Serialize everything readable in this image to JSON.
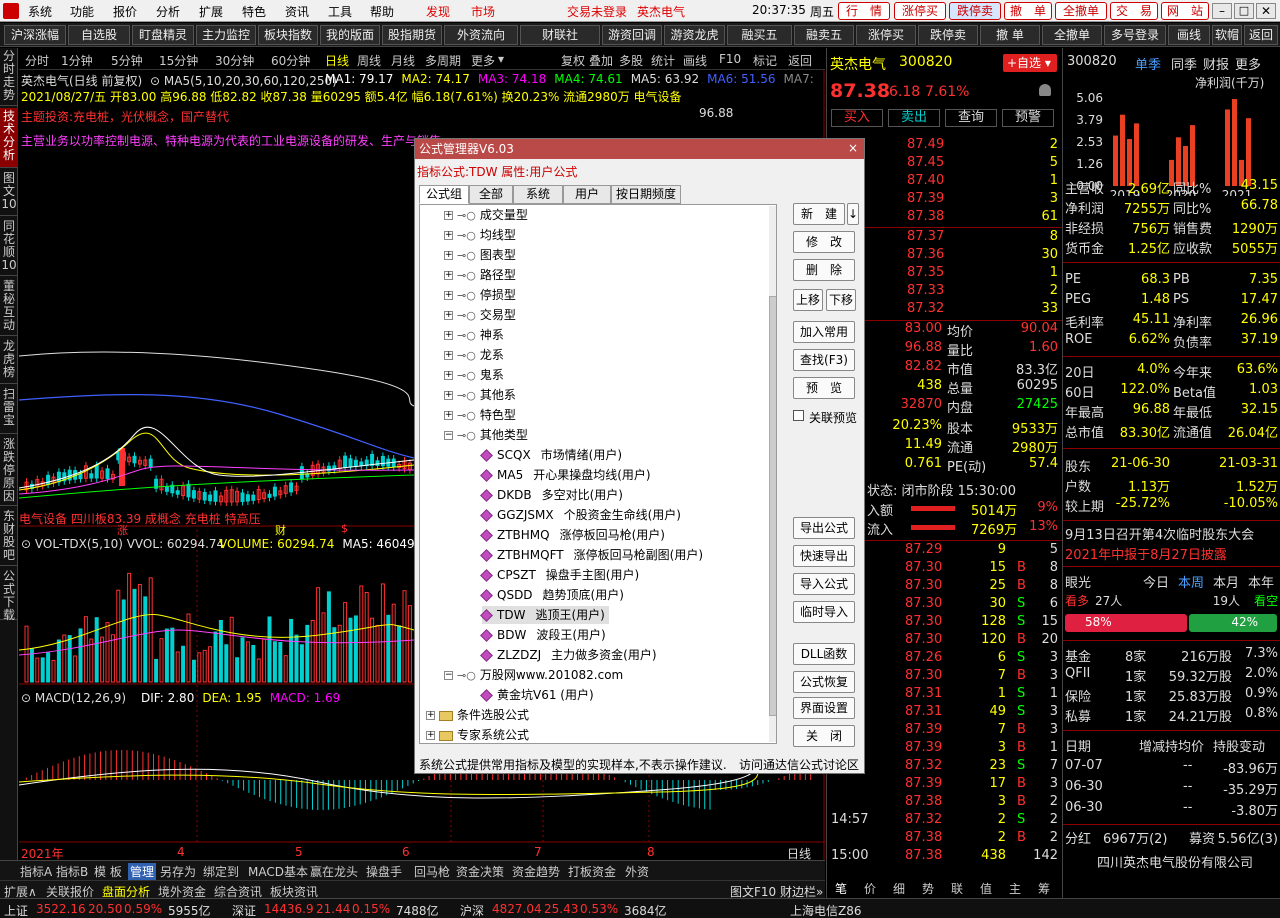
{
  "menu": {
    "items": [
      "系统",
      "功能",
      "报价",
      "分析",
      "扩展",
      "特色",
      "资讯",
      "工具",
      "帮助"
    ],
    "warn": "发现",
    "market": "市场",
    "login_status": "交易未登录",
    "stock_tag": "英杰电气",
    "time": "20:37:35",
    "weekday": "周五",
    "right_buttons": [
      "行　情",
      "涨停买",
      "跌停卖",
      "撤　单",
      "全撤单",
      "交　易",
      "网　站"
    ]
  },
  "toolbar": {
    "buttons": [
      "沪深涨幅",
      "自选股",
      "盯盘精灵",
      "主力监控",
      "板块指数",
      "我的版面",
      "股指期货",
      "外资流向",
      "财联社",
      "游资回调",
      "游资龙虎",
      "融买五",
      "融卖五",
      "涨停买",
      "跌停卖",
      "撤 单",
      "全撤单",
      "多号登录",
      "画线",
      "软帽",
      "返回"
    ]
  },
  "left_tabs": [
    "分时走势",
    "技术分析",
    "图文10",
    "同花顺10",
    "董秘互动",
    "龙虎榜",
    "扫雷宝",
    "涨跌停原因",
    "东财股吧",
    "公式下载"
  ],
  "period": {
    "items": [
      "分时",
      "1分钟",
      "5分钟",
      "15分钟",
      "30分钟",
      "60分钟",
      "日线",
      "周线",
      "月线",
      "多周期",
      "更多"
    ],
    "active": "日线",
    "right": [
      "复权",
      "叠加",
      "多股",
      "统计",
      "画线",
      "F10",
      "标记",
      "返回"
    ]
  },
  "chart": {
    "title": "英杰电气(日线 前复权)",
    "ma_label": "MA5(5,10,20,30,60,120,250)",
    "ma": [
      {
        "t": "MA1: 79.17",
        "c": "#ffffff"
      },
      {
        "t": "MA2: 74.17",
        "c": "#ffff00"
      },
      {
        "t": "MA3: 74.18",
        "c": "#ff00ff"
      },
      {
        "t": "MA4: 74.61",
        "c": "#00ff00"
      },
      {
        "t": "MA5: 63.92",
        "c": "#dddddd"
      },
      {
        "t": "MA6: 51.56",
        "c": "#4060ff"
      },
      {
        "t": "MA7:",
        "c": "#888888"
      }
    ],
    "bar_info": "2021/08/27/五 开83.00 高96.88 低82.82 收87.38 量60295 额5.4亿 幅6.18(7.61%) 换20.23% 流通2980万 电气设备",
    "theme1": "主题投资:充电桩，光伏概念，国产替代",
    "theme2": "主营业务以功率控制电源、特种电源为代表的工业电源设备的研发、生产与销售",
    "max_label": "96.88",
    "bottom_note": "电气设备 四川板83.39 成概念 充电桩 特高压",
    "marks": [
      "涨",
      "财",
      "$"
    ],
    "vol_label": "VOL-TDX(5,10) VVOL: 60294.74",
    "vol_vals": [
      {
        "t": "VOLUME: 60294.74",
        "c": "#ffff00"
      },
      {
        "t": "MA5: 46049.09",
        "c": "#ffffff"
      }
    ],
    "macd_label": "MACD(12,26,9)",
    "macd_vals": [
      {
        "t": "DIF: 2.80",
        "c": "#ffffff"
      },
      {
        "t": "DEA: 1.95",
        "c": "#ffff00"
      },
      {
        "t": "MACD: 1.69",
        "c": "#ff00ff"
      }
    ],
    "xaxis": [
      "2021年",
      "4",
      "5",
      "6",
      "7",
      "8"
    ],
    "daily_btn": "日线"
  },
  "bottom_tabs": [
    "指标A",
    "指标B",
    "模 板",
    "管理",
    "另存为",
    "绑定到",
    "MACD基本",
    "赢在龙头",
    "操盘手",
    "回马枪",
    "资金决策",
    "资金趋势",
    "打板资金",
    "外资"
  ],
  "bottom_tabs2": [
    "扩展∧",
    "关联报价",
    "盘面分析",
    "境外资金",
    "综合资讯",
    "板块资讯"
  ],
  "bottom_right": "图文F10 财边栏»",
  "status": {
    "items": [
      {
        "n": "上证",
        "v": "3522.16",
        "c": "20.50",
        "p": "0.59%",
        "a": "5955亿"
      },
      {
        "n": "深证",
        "v": "14436.9",
        "c": "21.44",
        "p": "0.15%",
        "a": "7488亿"
      },
      {
        "n": "沪深",
        "v": "4827.04",
        "c": "25.43",
        "p": "0.53%",
        "a": "3684亿"
      }
    ],
    "server": "上海电信Z86"
  },
  "quote": {
    "name": "英杰电气",
    "code": "300820",
    "add": "+自选",
    "price": "87.38",
    "chg": "6.18",
    "pct": "7.61%",
    "btns": [
      "买入",
      "卖出",
      "查询",
      "预警"
    ],
    "asks": [
      {
        "p": "87.49",
        "v": "2"
      },
      {
        "p": "87.45",
        "v": "5"
      },
      {
        "p": "87.40",
        "v": "1"
      },
      {
        "p": "87.39",
        "v": "3"
      },
      {
        "p": "87.38",
        "v": "61"
      }
    ],
    "bids": [
      {
        "p": "87.37",
        "v": "8"
      },
      {
        "p": "87.36",
        "v": "30"
      },
      {
        "p": "87.35",
        "v": "1"
      },
      {
        "p": "87.33",
        "v": "2"
      },
      {
        "p": "87.32",
        "v": "33"
      }
    ],
    "stats": [
      {
        "a": "83.00",
        "l": "均价",
        "b": "90.04",
        "bc": "#ff3333"
      },
      {
        "a": "96.88",
        "l": "量比",
        "b": "1.60",
        "bc": "#ff3333"
      },
      {
        "a": "82.82",
        "l": "市值",
        "b": "83.3亿",
        "bc": "#dddddd"
      },
      {
        "a": "438",
        "l": "总量",
        "b": "60295",
        "bc": "#dddddd"
      },
      {
        "a": "32870",
        "l": "内盘",
        "b": "27425",
        "bc": "#00ff00"
      }
    ],
    "stats2": [
      {
        "a": "20.23%",
        "l": "股本",
        "b": "9533万"
      },
      {
        "a": "11.49",
        "l": "流通",
        "b": "2980万"
      },
      {
        "a": "0.761",
        "l": "PE(动)",
        "b": "57.4"
      }
    ],
    "state": "状态: 闭市阶段 15:30:00",
    "flow": [
      {
        "l": "入额",
        "v": "5014万",
        "p": "9%"
      },
      {
        "l": "流入",
        "v": "7269万",
        "p": "13%"
      }
    ],
    "ticks": [
      {
        "t": "",
        "p": "87.29",
        "v": "9",
        "f": "",
        "n": "5"
      },
      {
        "t": "",
        "p": "87.30",
        "v": "15",
        "f": "B",
        "n": "8"
      },
      {
        "t": "",
        "p": "87.30",
        "v": "25",
        "f": "B",
        "n": "8"
      },
      {
        "t": "",
        "p": "87.30",
        "v": "30",
        "f": "S",
        "n": "6"
      },
      {
        "t": "",
        "p": "87.30",
        "v": "128",
        "f": "S",
        "n": "15"
      },
      {
        "t": "",
        "p": "87.30",
        "v": "120",
        "f": "B",
        "n": "20"
      },
      {
        "t": "",
        "p": "87.26",
        "v": "6",
        "f": "S",
        "n": "3"
      },
      {
        "t": "",
        "p": "87.30",
        "v": "7",
        "f": "B",
        "n": "3"
      },
      {
        "t": "",
        "p": "87.31",
        "v": "1",
        "f": "S",
        "n": "1"
      },
      {
        "t": "",
        "p": "87.31",
        "v": "49",
        "f": "S",
        "n": "3"
      },
      {
        "t": "",
        "p": "87.39",
        "v": "7",
        "f": "B",
        "n": "3"
      },
      {
        "t": "",
        "p": "87.39",
        "v": "3",
        "f": "B",
        "n": "1"
      },
      {
        "t": "",
        "p": "87.32",
        "v": "23",
        "f": "S",
        "n": "7"
      },
      {
        "t": "",
        "p": "87.39",
        "v": "17",
        "f": "B",
        "n": "3"
      },
      {
        "t": "",
        "p": "87.38",
        "v": "3",
        "f": "B",
        "n": "2"
      },
      {
        "t": "14:57",
        "p": "87.32",
        "v": "2",
        "f": "S",
        "n": "2"
      },
      {
        "t": "",
        "p": "87.38",
        "v": "2",
        "f": "B",
        "n": "2"
      },
      {
        "t": "15:00",
        "p": "87.38",
        "v": "438",
        "f": "",
        "n": "142"
      }
    ],
    "bottom_tabs": [
      "笔",
      "价",
      "细",
      "势",
      "联",
      "值",
      "主",
      "筹"
    ]
  },
  "fin": {
    "code": "300820",
    "tabs": [
      "单季",
      "同季",
      "财报",
      "更多"
    ],
    "chart_label": "净利润(千万)",
    "y_ticks": [
      "5.06",
      "3.79",
      "2.53",
      "1.26",
      "0.00"
    ],
    "chart_data": {
      "type": "bar",
      "categories": [
        "2019",
        "2020",
        "2021"
      ],
      "values": [
        2.9,
        4.1,
        2.7,
        3.6,
        1.5,
        2.8,
        2.3,
        3.5,
        4.4,
        5.0,
        1.5,
        3.9
      ]
    },
    "rows": [
      {
        "l": "主营收",
        "v": "2.69亿",
        "l2": "同比%",
        "v2": "43.15"
      },
      {
        "l": "净利润",
        "v": "7255万",
        "l2": "同比%",
        "v2": "66.78"
      },
      {
        "l": "非经损",
        "v": "756万",
        "l2": "销售费",
        "v2": "1290万"
      },
      {
        "l": "货币金",
        "v": "1.25亿",
        "l2": "应收款",
        "v2": "5055万"
      }
    ],
    "rows2": [
      {
        "l": "PE",
        "v": "68.3",
        "l2": "PB",
        "v2": "7.35"
      },
      {
        "l": "PEG",
        "v": "1.48",
        "l2": "PS",
        "v2": "17.47"
      },
      {
        "l": "毛利率",
        "v": "45.11",
        "l2": "净利率",
        "v2": "26.96"
      },
      {
        "l": "ROE",
        "v": "6.62%",
        "l2": "负债率",
        "v2": "37.19"
      }
    ],
    "rows3": [
      {
        "l": "20日",
        "v": "4.0%",
        "l2": "今年来",
        "v2": "63.6%"
      },
      {
        "l": "60日",
        "v": "122.0%",
        "l2": "Beta值",
        "v2": "1.03"
      },
      {
        "l": "年最高",
        "v": "96.88",
        "l2": "年最低",
        "v2": "32.15"
      },
      {
        "l": "总市值",
        "v": "83.30亿",
        "l2": "流通值",
        "v2": "26.04亿"
      }
    ],
    "rows4": [
      {
        "l": "股东",
        "v": "21-06-30",
        "v2": "21-03-31"
      },
      {
        "l": "户数",
        "v": "1.13万",
        "v2": "1.52万"
      },
      {
        "l": "较上期",
        "v": "-25.72%",
        "v2": "-10.05%"
      }
    ],
    "notice1": "9月13日召开第4次临时股东大会",
    "notice2": "2021年中报于8月27日披露",
    "view": {
      "title": "眼光",
      "tabs": [
        "今日",
        "本周",
        "本月",
        "本年"
      ],
      "bull": "看多",
      "bull_n": "27人",
      "bear_n": "19人",
      "bear": "看空",
      "bull_p": "58%",
      "bear_p": "42%"
    },
    "inst": [
      {
        "l": "基金",
        "n": "8家",
        "v": "216万股",
        "p": "7.3%"
      },
      {
        "l": "QFII",
        "n": "1家",
        "v": "59.32万股",
        "p": "2.0%"
      },
      {
        "l": "保险",
        "n": "1家",
        "v": "25.83万股",
        "p": "0.9%"
      },
      {
        "l": "私募",
        "n": "1家",
        "v": "24.21万股",
        "p": "0.8%"
      }
    ],
    "hold_head": [
      "日期",
      "增减持均价",
      "持股变动"
    ],
    "hold": [
      {
        "d": "07-07",
        "p": "--",
        "c": "-83.96万"
      },
      {
        "d": "06-30",
        "p": "--",
        "c": "-35.29万"
      },
      {
        "d": "06-30",
        "p": "--",
        "c": "-3.80万"
      }
    ],
    "bonus": {
      "l": "分红",
      "v": "6967万(2)",
      "l2": "募资",
      "v2": "5.56亿(3)"
    },
    "company": "四川英杰电气股份有限公司"
  },
  "dialog": {
    "title": "公式管理器V6.03",
    "close": "×",
    "sub": "指标公式:TDW 属性:用户公式",
    "tabs": [
      "公式组",
      "全部",
      "系统",
      "用户",
      "按日期频度"
    ],
    "groups": [
      "成交量型",
      "均线型",
      "图表型",
      "路径型",
      "停损型",
      "交易型",
      "神系",
      "龙系",
      "鬼系",
      "其他系",
      "特色型",
      "其他类型"
    ],
    "items": [
      {
        "c": "SCQX",
        "d": "市场情绪(用户)"
      },
      {
        "c": "MA5",
        "d": "开心果操盘均线(用户)"
      },
      {
        "c": "DKDB",
        "d": "多空对比(用户)"
      },
      {
        "c": "GGZJSMX",
        "d": "个股资金生命线(用户)"
      },
      {
        "c": "ZTBHMQ",
        "d": "涨停板回马枪(用户)"
      },
      {
        "c": "ZTBHMQFT",
        "d": "涨停板回马枪副图(用户)"
      },
      {
        "c": "CPSZT",
        "d": "操盘手主图(用户)"
      },
      {
        "c": "QSDD",
        "d": "趋势顶底(用户)"
      },
      {
        "c": "TDW",
        "d": "逃顶王(用户)"
      },
      {
        "c": "BDW",
        "d": "波段王(用户)"
      },
      {
        "c": "ZLZDZJ",
        "d": "主力做多资金(用户)"
      }
    ],
    "site": "万股网www.201082.com",
    "site_item": "黄金坑V61  (用户)",
    "folders": [
      "条件选股公式",
      "专家系统公式"
    ],
    "buttons": [
      "新　建",
      "修　改",
      "删　除",
      "上移",
      "下移",
      "加入常用",
      "查找(F3)",
      "预　览",
      "导出公式",
      "快速导出",
      "导入公式",
      "临时导入",
      "DLL函数",
      "公式恢复",
      "界面设置",
      "关　闭"
    ],
    "preview_check": "关联预览",
    "footer": "系统公式提供常用指标及模型的实现样本,不表示操作建议.",
    "footer_link": "访问通达信公式讨论区"
  }
}
